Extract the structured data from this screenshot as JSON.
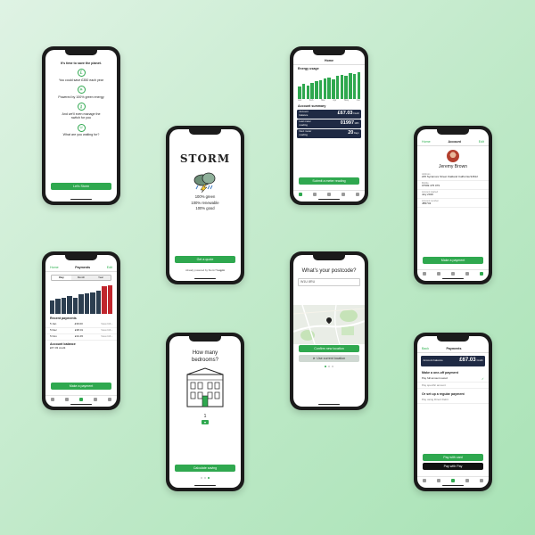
{
  "colors": {
    "accent": "#2fa84f",
    "navy": "#1f2a44",
    "red": "#c0262d",
    "bar": "#2c3e50"
  },
  "onboarding": {
    "heading": "It's time to save the planet.",
    "items": [
      {
        "icon": "pound-icon",
        "glyph": "£",
        "text": "You could save £350 each year"
      },
      {
        "icon": "sun-icon",
        "glyph": "☀",
        "text": "Powered by 100% green energy"
      },
      {
        "icon": "key-icon",
        "glyph": "⚷",
        "text": "And we'll even manage the switch for you"
      },
      {
        "icon": "smile-icon",
        "glyph": "☺",
        "text": "What are you waiting for?"
      }
    ],
    "button": "Let's Storm"
  },
  "home": {
    "title": "Home",
    "section": "Energy usage",
    "bars": [
      0.45,
      0.55,
      0.5,
      0.6,
      0.65,
      0.7,
      0.75,
      0.8,
      0.72,
      0.85,
      0.9,
      0.88,
      0.95,
      0.92,
      1.0
    ],
    "months": [
      "Jan",
      "Feb",
      "Mar",
      "Apr",
      "May",
      "Jun"
    ],
    "summary_title": "Account summary",
    "cards": [
      {
        "label": "Account balance",
        "value": "£67.03",
        "tag": "Credit"
      },
      {
        "label": "Last meter reading",
        "value": "01997",
        "tag": "kWh"
      },
      {
        "label": "Next meter reading",
        "value": "20",
        "tag": "Days"
      }
    ],
    "button": "Submit a meter reading"
  },
  "brand": {
    "logo": "STORM",
    "lines": [
      "100% green",
      "100% renewable",
      "100% good"
    ],
    "button": "Get a quote",
    "footer": "Already powered by Storm?",
    "footer_link": "Log in"
  },
  "account": {
    "back": "Home",
    "title": "Account",
    "edit": "Edit",
    "name": "Jeremy Brown",
    "fields": [
      {
        "label": "Address",
        "value": "225 Sycamore Street Oakland California 94612"
      },
      {
        "label": "Mobile",
        "value": "07599 475 079"
      },
      {
        "label": "Account started",
        "value": "July 2019"
      },
      {
        "label": "Account number",
        "value": "JB5743"
      }
    ],
    "button": "Make a payment"
  },
  "payments": {
    "back": "Home",
    "title": "Payments",
    "edit": "Edit",
    "segments": [
      "Day",
      "Month",
      "Year"
    ],
    "bars": [
      0.45,
      0.5,
      0.55,
      0.6,
      0.55,
      0.65,
      0.7,
      0.72,
      0.78,
      0.92,
      0.95
    ],
    "red_from": 9,
    "section": "Recent payments",
    "rows": [
      {
        "date": "5 Jan",
        "amount": "£39.00",
        "link": "View bill ›"
      },
      {
        "date": "5 Dec",
        "amount": "£38.01",
        "link": "View bill ›"
      },
      {
        "date": "5 Nov",
        "amount": "£34.45",
        "link": "View bill ›"
      }
    ],
    "balance_title": "Account balance",
    "balance": "£67.03 credit",
    "button": "Make a payment"
  },
  "postcode": {
    "heading": "What's your postcode?",
    "input": "W1U 8RU",
    "button": "Confirm new location",
    "button2": "Use current location"
  },
  "bedrooms": {
    "heading": "How many bedrooms?",
    "count": "1",
    "button": "Calculate saving"
  },
  "payment2": {
    "back": "Back",
    "title": "Payments",
    "balance_label": "Account balance",
    "balance": "£67.03",
    "balance_tag": "Credit",
    "oneoff": "Make a one-off payment",
    "opt1": "Pay full amount owed",
    "opt2": "Pay specific amount",
    "regular": "Or set up a regular payment",
    "opt3": "Pay using Direct Debit",
    "pay_card": "Pay with card",
    "pay_apple": "Pay with  Pay"
  }
}
